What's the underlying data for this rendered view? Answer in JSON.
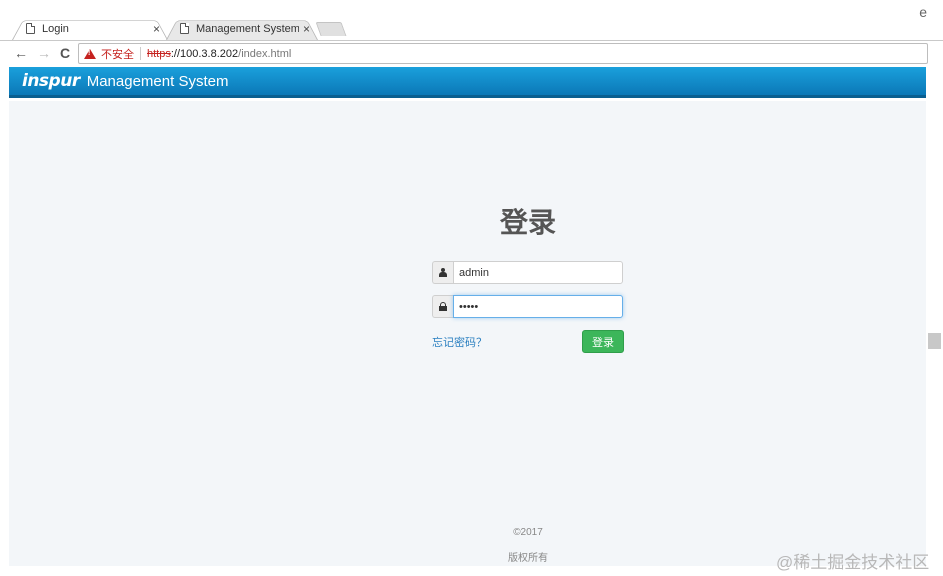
{
  "browser": {
    "tabs": [
      {
        "label": "Login",
        "close": "×"
      },
      {
        "label": "Management System",
        "close": "×"
      }
    ],
    "profile_letter": "e",
    "nav": {
      "back": "←",
      "forward": "→",
      "reload": "C"
    },
    "address": {
      "security_label": "不安全",
      "scheme": "https",
      "host": "://100.3.8.202",
      "path": "/index.html"
    }
  },
  "header": {
    "logo": "inspur",
    "title": "Management System"
  },
  "login": {
    "title": "登录",
    "username_value": "admin",
    "password_mask": "•••••",
    "forgot_label": "忘记密码？",
    "submit_label": "登录"
  },
  "footer": {
    "copyright": "©2017",
    "rights": "版权所有"
  },
  "watermark": "@稀土掘金技术社区",
  "colors": {
    "header_blue": "#1a9cd8",
    "button_green": "#3cb65a",
    "link_blue": "#2a7fc0",
    "insecure_red": "#c5221f"
  }
}
